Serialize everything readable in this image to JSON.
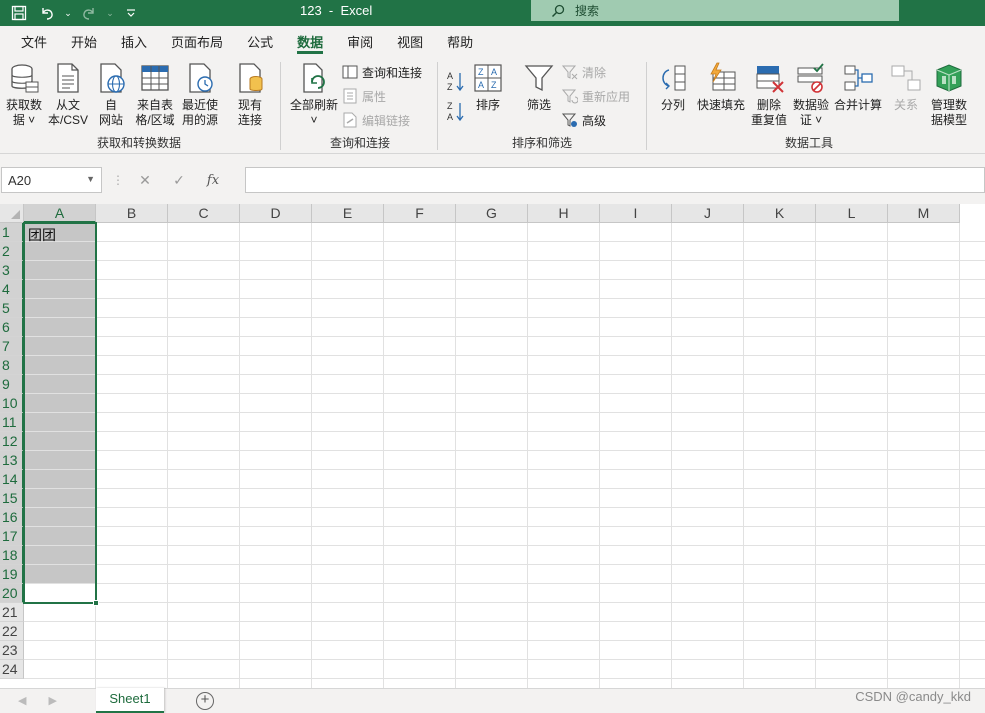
{
  "title_bar": {
    "doc_name": "123",
    "app_name": "Excel",
    "search_placeholder": "搜索",
    "icons": [
      "save-icon",
      "undo-icon",
      "redo-icon",
      "customize-qat-icon",
      "search-icon"
    ]
  },
  "menu": {
    "tabs": [
      "文件",
      "开始",
      "插入",
      "页面布局",
      "公式",
      "数据",
      "审阅",
      "视图",
      "帮助"
    ],
    "active_tab": "数据"
  },
  "ribbon": {
    "get_transform": {
      "label": "获取和转换数据",
      "get_data": "获取数\n据 ˅",
      "from_text_csv": "从文\n本/CSV",
      "from_web": "自\n网站",
      "from_table": "来自表\n格/区域",
      "recent_sources": "最近使\n用的源",
      "existing_connections": "现有\n连接"
    },
    "queries": {
      "label": "查询和连接",
      "refresh_all": "全部刷新\n˅",
      "queries_connections": "查询和连接",
      "properties": "属性",
      "edit_links": "编辑链接"
    },
    "sort_filter": {
      "label": "排序和筛选",
      "sort": "排序",
      "filter": "筛选",
      "clear": "清除",
      "reapply": "重新应用",
      "advanced": "高级"
    },
    "data_tools": {
      "label": "数据工具",
      "text_to_columns": "分列",
      "flash_fill": "快速填充",
      "remove_duplicates": "删除\n重复值",
      "data_validation": "数据验\n证 ˅",
      "consolidate": "合并计算",
      "relationships": "关系",
      "manage_data_model": "管理数\n据模型"
    }
  },
  "formula_bar": {
    "name_box": "A20",
    "cancel": "✕",
    "enter": "✓",
    "fx": "fx",
    "value": ""
  },
  "sheet": {
    "columns": [
      "A",
      "B",
      "C",
      "D",
      "E",
      "F",
      "G",
      "H",
      "I",
      "J",
      "K",
      "L",
      "M"
    ],
    "rows": [
      "1",
      "2",
      "3",
      "4",
      "5",
      "6",
      "7",
      "8",
      "9",
      "10",
      "11",
      "12",
      "13",
      "14",
      "15",
      "16",
      "17",
      "18",
      "19",
      "20",
      "21",
      "22",
      "23",
      "24"
    ],
    "selection": "A1:A20",
    "active_cell": "A20",
    "cells": {
      "A1": "团团"
    }
  },
  "status_bar": {
    "sheet_tabs": [
      "Sheet1"
    ],
    "active_sheet": "Sheet1",
    "add_sheet": "+",
    "watermark": "CSDN @candy_kkd"
  },
  "colors": {
    "accent": "#217346",
    "selection_fill": "#c6c6c6",
    "search_bg": "#a0cbb1"
  }
}
